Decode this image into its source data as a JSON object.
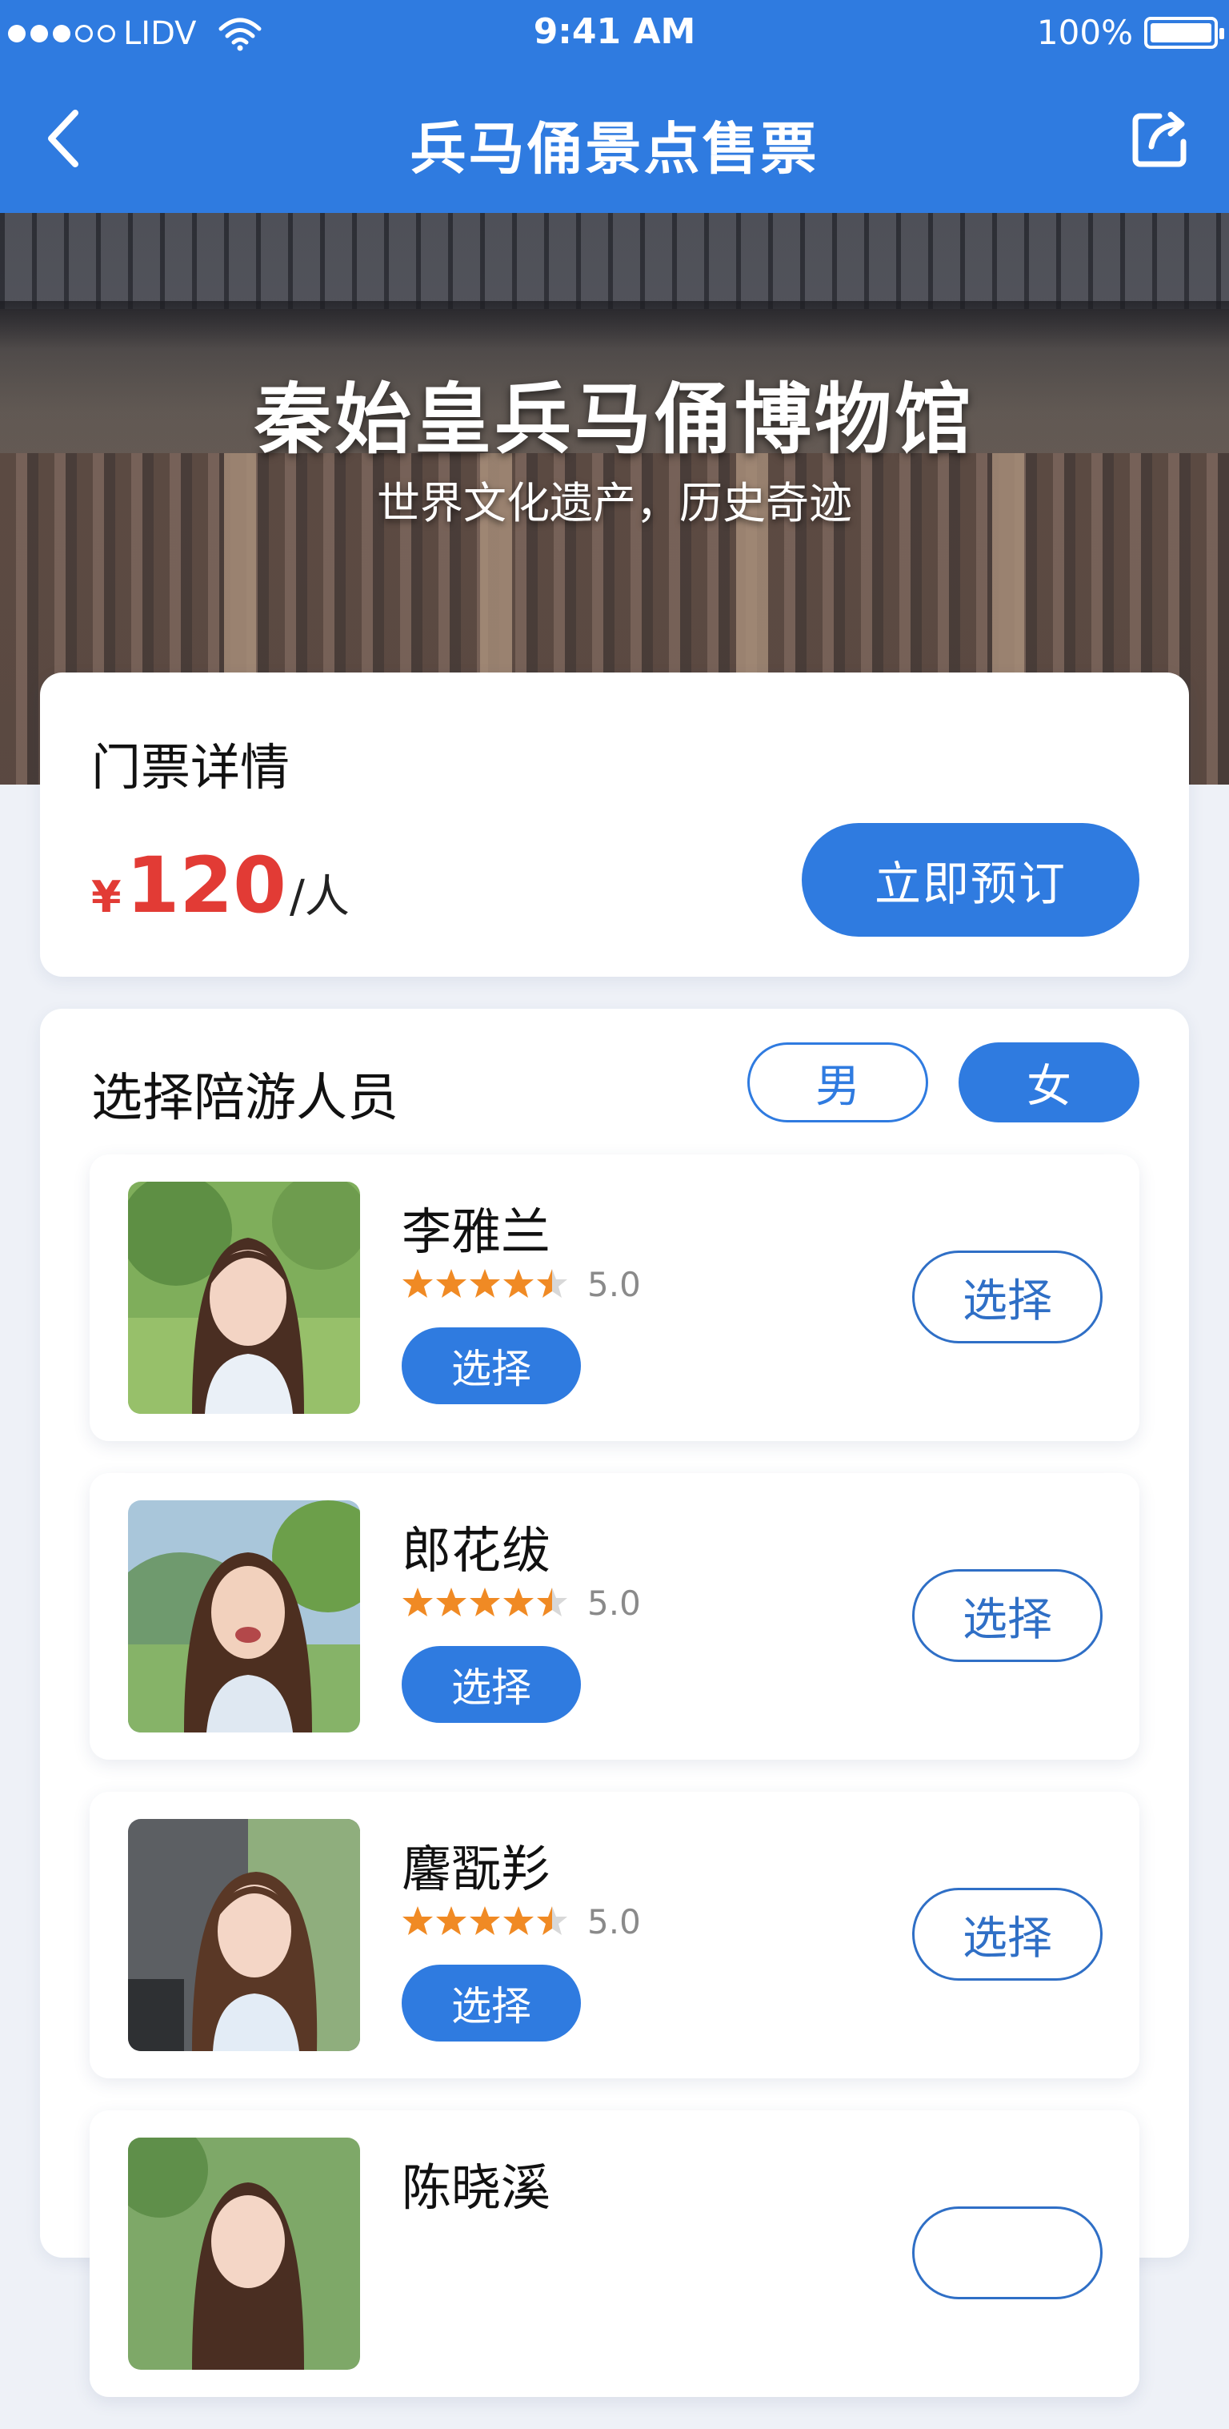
{
  "status_bar": {
    "carrier": "LIDV",
    "time": "9:41 AM",
    "battery": "100%"
  },
  "nav": {
    "title": "兵马俑景点售票",
    "back_icon": "chevron-left-icon",
    "share_icon": "share-icon"
  },
  "hero": {
    "title": "秦始皇兵马俑博物馆",
    "subtitle": "世界文化遗产，历史奇迹"
  },
  "ticket": {
    "heading": "门票详情",
    "currency": "¥",
    "price": "120",
    "unit": "/人",
    "book_label": "立即预订"
  },
  "guides": {
    "heading": "选择陪游人员",
    "gender_male": "男",
    "gender_female": "女",
    "gender_selected": "女",
    "items": [
      {
        "name": "李雅兰",
        "rating": "5.0",
        "stars": 4.5,
        "select_label": "选择",
        "select_outline_label": "选择"
      },
      {
        "name": "郎花绂",
        "rating": "5.0",
        "stars": 4.5,
        "select_label": "选择",
        "select_outline_label": "选择"
      },
      {
        "name": "麘翫羏",
        "rating": "5.0",
        "stars": 4.5,
        "select_label": "选择",
        "select_outline_label": "选择"
      },
      {
        "name": "陈晓溪",
        "rating": "",
        "stars": 0,
        "select_label": "",
        "select_outline_label": ""
      }
    ]
  },
  "colors": {
    "primary": "#2f7be0",
    "price": "#e23b35",
    "star": "#f08a24"
  }
}
